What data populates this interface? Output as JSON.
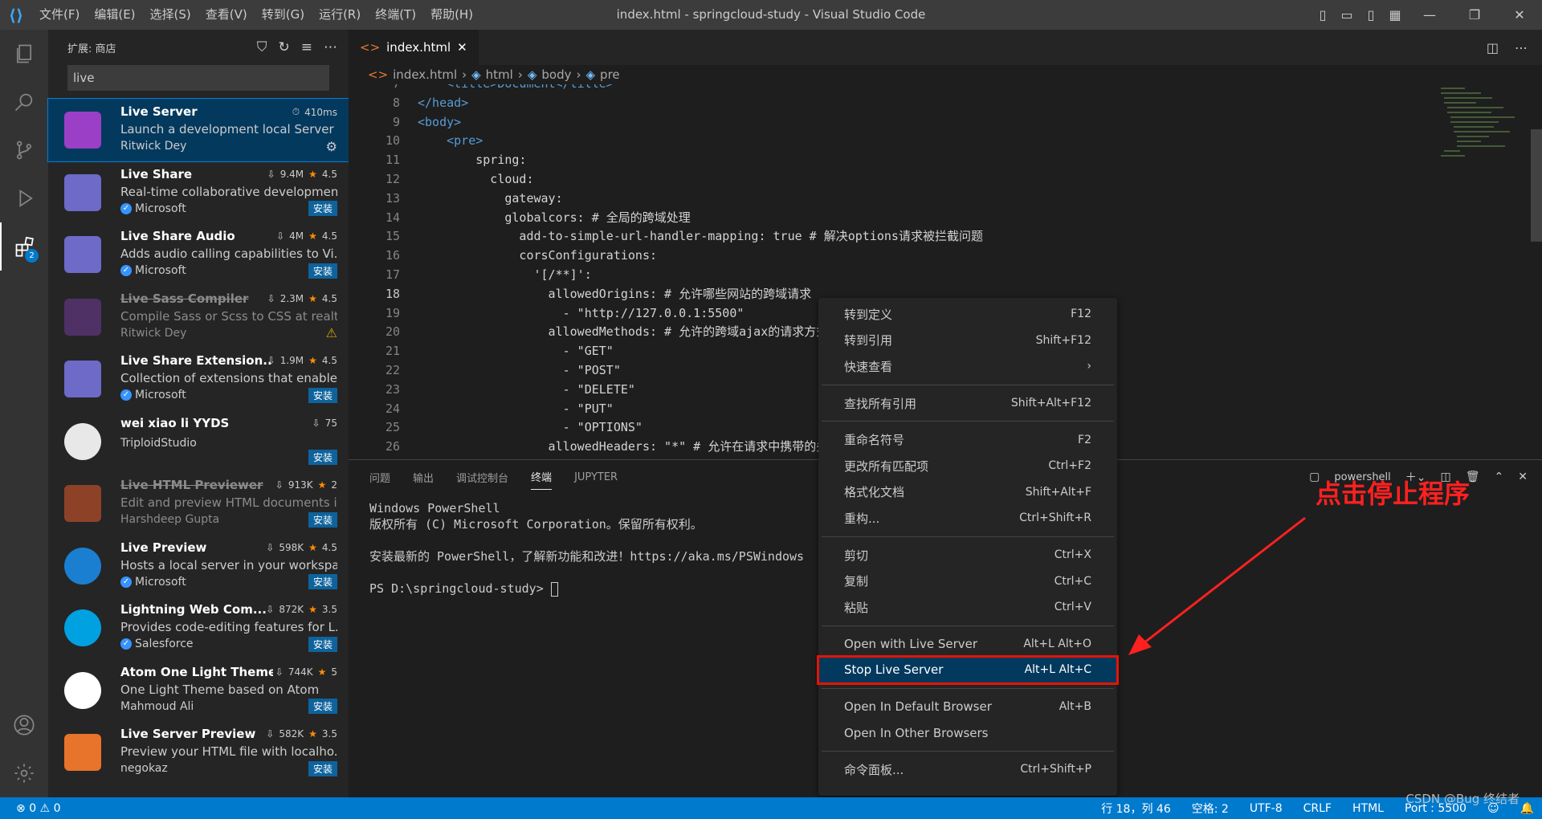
{
  "window": {
    "title": "index.html - springcloud-study - Visual Studio Code",
    "menu": [
      "文件(F)",
      "编辑(E)",
      "选择(S)",
      "查看(V)",
      "转到(G)",
      "运行(R)",
      "终端(T)",
      "帮助(H)"
    ]
  },
  "activity": {
    "extensions_badge": "2"
  },
  "sidebar": {
    "header": "扩展: 商店",
    "search_value": "live",
    "extensions": [
      {
        "name": "Live Server",
        "desc": "Launch a development local Server ...",
        "publisher": "Ritwick Dey",
        "stat": "410ms",
        "rating": "",
        "action": "gear",
        "verified": false,
        "disabled": false,
        "icon_color": "#9b3fc6"
      },
      {
        "name": "Live Share",
        "desc": "Real-time collaborative developmen...",
        "publisher": "Microsoft",
        "stat": "9.4M",
        "rating": "4.5",
        "action": "安装",
        "verified": true,
        "disabled": false,
        "icon_color": "#6d6ac8"
      },
      {
        "name": "Live Share Audio",
        "desc": "Adds audio calling capabilities to Vi...",
        "publisher": "Microsoft",
        "stat": "4M",
        "rating": "4.5",
        "action": "安装",
        "verified": true,
        "disabled": false,
        "icon_color": "#6d6ac8"
      },
      {
        "name": "Live Sass Compiler",
        "desc": "Compile Sass or Scss to CSS at realti...",
        "publisher": "Ritwick Dey",
        "stat": "2.3M",
        "rating": "4.5",
        "action": "warn",
        "verified": false,
        "disabled": true,
        "icon_color": "#6c3b8f"
      },
      {
        "name": "Live Share Extension...",
        "desc": "Collection of extensions that enable...",
        "publisher": "Microsoft",
        "stat": "1.9M",
        "rating": "4.5",
        "action": "安装",
        "verified": true,
        "disabled": false,
        "icon_color": "#6d6ac8"
      },
      {
        "name": "wei xiao li YYDS",
        "desc": "",
        "publisher": "TriploidStudio",
        "stat": "75",
        "rating": "",
        "action": "安装",
        "verified": false,
        "disabled": false,
        "icon_color": "#e8e8e8"
      },
      {
        "name": "Live HTML Previewer",
        "desc": "Edit and preview HTML documents i...",
        "publisher": "Harshdeep Gupta",
        "stat": "913K",
        "rating": "2",
        "action": "安装",
        "verified": false,
        "disabled": true,
        "icon_color": "#d4572a"
      },
      {
        "name": "Live Preview",
        "desc": "Hosts a local server in your workspa...",
        "publisher": "Microsoft",
        "stat": "598K",
        "rating": "4.5",
        "action": "安装",
        "verified": true,
        "disabled": false,
        "icon_color": "#1a7fd1"
      },
      {
        "name": "Lightning Web Com...",
        "desc": "Provides code-editing features for L...",
        "publisher": "Salesforce",
        "stat": "872K",
        "rating": "3.5",
        "action": "安装",
        "verified": true,
        "disabled": false,
        "icon_color": "#00a1e0"
      },
      {
        "name": "Atom One Light Theme",
        "desc": "One Light Theme based on Atom",
        "publisher": "Mahmoud Ali",
        "stat": "744K",
        "rating": "5",
        "action": "安装",
        "verified": false,
        "disabled": false,
        "icon_color": "#ffffff"
      },
      {
        "name": "Live Server Preview",
        "desc": "Preview your HTML file with localho...",
        "publisher": "negokaz",
        "stat": "582K",
        "rating": "3.5",
        "action": "安装",
        "verified": false,
        "disabled": false,
        "icon_color": "#e8732a"
      }
    ]
  },
  "editor": {
    "tab": "index.html",
    "breadcrumb": [
      "index.html",
      "html",
      "body",
      "pre"
    ],
    "lines": [
      {
        "n": "7",
        "text": "    <title>Document</title>",
        "cls": "tg"
      },
      {
        "n": "8",
        "text": "</head>",
        "cls": "tg"
      },
      {
        "n": "9",
        "text": "<body>",
        "cls": "tg"
      },
      {
        "n": "10",
        "text": "    <pre>",
        "cls": "tg"
      },
      {
        "n": "11",
        "text": "        spring:",
        "cls": ""
      },
      {
        "n": "12",
        "text": "          cloud:",
        "cls": ""
      },
      {
        "n": "13",
        "text": "            gateway:",
        "cls": ""
      },
      {
        "n": "14",
        "text": "            globalcors: # 全局的跨域处理",
        "cls": ""
      },
      {
        "n": "15",
        "text": "              add-to-simple-url-handler-mapping: true # 解决options请求被拦截问题",
        "cls": ""
      },
      {
        "n": "16",
        "text": "              corsConfigurations:",
        "cls": ""
      },
      {
        "n": "17",
        "text": "                '[/**]':",
        "cls": ""
      },
      {
        "n": "18",
        "text": "                  allowedOrigins: # 允许哪些网站的跨域请求",
        "cls": "",
        "cur": true
      },
      {
        "n": "19",
        "text": "                    - \"http://127.0.0.1:5500\"",
        "cls": ""
      },
      {
        "n": "20",
        "text": "                  allowedMethods: # 允许的跨域ajax的请求方式",
        "cls": ""
      },
      {
        "n": "21",
        "text": "                    - \"GET\"",
        "cls": ""
      },
      {
        "n": "22",
        "text": "                    - \"POST\"",
        "cls": ""
      },
      {
        "n": "23",
        "text": "                    - \"DELETE\"",
        "cls": ""
      },
      {
        "n": "24",
        "text": "                    - \"PUT\"",
        "cls": ""
      },
      {
        "n": "25",
        "text": "                    - \"OPTIONS\"",
        "cls": ""
      },
      {
        "n": "26",
        "text": "                  allowedHeaders: \"*\" # 允许在请求中携带的头信息",
        "cls": ""
      }
    ]
  },
  "panel": {
    "tabs": [
      "问题",
      "输出",
      "调试控制台",
      "终端",
      "JUPYTER"
    ],
    "active_tab": "终端",
    "shell": "powershell",
    "terminal": [
      "Windows PowerShell",
      "版权所有 (C) Microsoft Corporation。保留所有权利。",
      "",
      "安装最新的 PowerShell，了解新功能和改进！https://aka.ms/PSWindows",
      "",
      "PS D:\\springcloud-study> "
    ]
  },
  "context_menu": {
    "groups": [
      [
        {
          "label": "转到定义",
          "key": "F12"
        },
        {
          "label": "转到引用",
          "key": "Shift+F12"
        },
        {
          "label": "快速查看",
          "key": "›"
        }
      ],
      [
        {
          "label": "查找所有引用",
          "key": "Shift+Alt+F12"
        }
      ],
      [
        {
          "label": "重命名符号",
          "key": "F2"
        },
        {
          "label": "更改所有匹配项",
          "key": "Ctrl+F2"
        },
        {
          "label": "格式化文档",
          "key": "Shift+Alt+F"
        },
        {
          "label": "重构...",
          "key": "Ctrl+Shift+R"
        }
      ],
      [
        {
          "label": "剪切",
          "key": "Ctrl+X"
        },
        {
          "label": "复制",
          "key": "Ctrl+C"
        },
        {
          "label": "粘贴",
          "key": "Ctrl+V"
        }
      ],
      [
        {
          "label": "Open with Live Server",
          "key": "Alt+L Alt+O"
        },
        {
          "label": "Stop Live Server",
          "key": "Alt+L Alt+C",
          "highlight": true
        }
      ],
      [
        {
          "label": "Open In Default Browser",
          "key": "Alt+B"
        },
        {
          "label": "Open In Other Browsers",
          "key": ""
        }
      ],
      [
        {
          "label": "命令面板...",
          "key": "Ctrl+Shift+P"
        }
      ]
    ]
  },
  "annotation": "点击停止程序",
  "status": {
    "errors": "0",
    "warnings": "0",
    "position": "行 18，列 46",
    "spaces": "空格: 2",
    "encoding": "UTF-8",
    "eol": "CRLF",
    "language": "HTML",
    "port": "Port : 5500"
  },
  "watermark": "CSDN @Bug 终结者",
  "colors": {
    "accent": "#007acc",
    "highlight_box": "#e51400",
    "annotation": "#ff2020"
  }
}
